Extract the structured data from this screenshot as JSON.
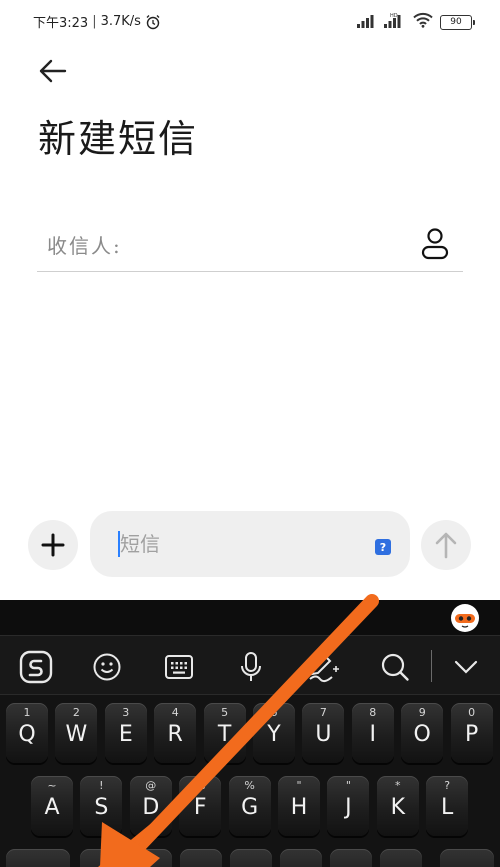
{
  "status_bar": {
    "time": "下午3:23",
    "network_speed": "3.7K/s",
    "separator": "|",
    "battery_level": "90",
    "icons": [
      "alarm-icon",
      "signal-icon",
      "hd-signal-icon",
      "wifi-icon",
      "battery-icon"
    ]
  },
  "header": {
    "back_icon": "back-arrow-icon",
    "title": "新建短信"
  },
  "recipient": {
    "label": "收信人:",
    "contact_icon": "contact-person-icon"
  },
  "composer": {
    "add_icon": "plus-icon",
    "placeholder": "短信",
    "help_badge": "?",
    "send_icon": "send-arrow-icon"
  },
  "keyboard": {
    "toolbar_icons": [
      "sogou-logo-icon",
      "emoji-icon",
      "keyboard-icon",
      "microphone-icon",
      "handwriting-icon",
      "search-icon",
      "collapse-chevron-icon"
    ],
    "row1": [
      {
        "num": "1",
        "letter": "Q"
      },
      {
        "num": "2",
        "letter": "W"
      },
      {
        "num": "3",
        "letter": "E"
      },
      {
        "num": "4",
        "letter": "R"
      },
      {
        "num": "5",
        "letter": "T"
      },
      {
        "num": "6",
        "letter": "Y"
      },
      {
        "num": "7",
        "letter": "U"
      },
      {
        "num": "8",
        "letter": "I"
      },
      {
        "num": "9",
        "letter": "O"
      },
      {
        "num": "0",
        "letter": "P"
      }
    ],
    "row2": [
      {
        "num": "~",
        "letter": "A"
      },
      {
        "num": "!",
        "letter": "S"
      },
      {
        "num": "@",
        "letter": "D"
      },
      {
        "num": "%",
        "letter": "F"
      },
      {
        "num": "%",
        "letter": "G"
      },
      {
        "num": "\"",
        "letter": "H"
      },
      {
        "num": "\"",
        "letter": "J"
      },
      {
        "num": "*",
        "letter": "K"
      },
      {
        "num": "?",
        "letter": "L"
      }
    ]
  },
  "colors": {
    "keyboard_bg": "#131313",
    "caret": "#2a80ff",
    "help_badge": "#2f6fe0",
    "arrow_overlay": "#f26b1d"
  }
}
